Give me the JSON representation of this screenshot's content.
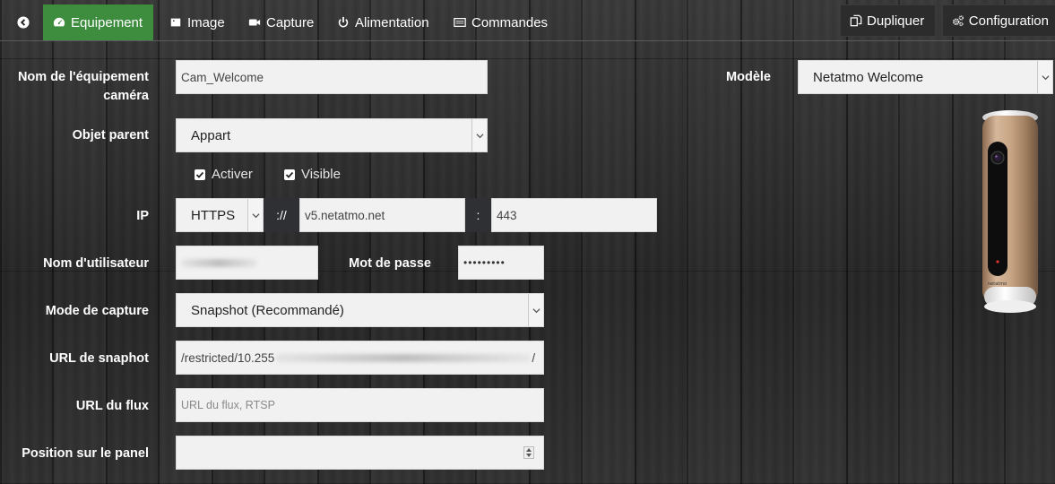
{
  "tabs": {
    "back_icon": "arrow-circle-left-icon",
    "items": [
      {
        "label": "Equipement",
        "icon": "tachometer-icon",
        "active": true
      },
      {
        "label": "Image",
        "icon": "picture-icon",
        "active": false
      },
      {
        "label": "Capture",
        "icon": "video-camera-icon",
        "active": false
      },
      {
        "label": "Alimentation",
        "icon": "power-icon",
        "active": false
      },
      {
        "label": "Commandes",
        "icon": "list-icon",
        "active": false
      }
    ]
  },
  "actions": {
    "duplicate_label": "Dupliquer",
    "configuration_label": "Configuration"
  },
  "form": {
    "name_label": "Nom de l'équipement caméra",
    "name_value": "Cam_Welcome",
    "parent_label": "Objet parent",
    "parent_value": "Appart",
    "activate_label": "Activer",
    "visible_label": "Visible",
    "ip_label": "IP",
    "protocol_value": "HTTPS",
    "protocol_separator": "://",
    "host_value": "v5.netatmo.net",
    "port_separator": ":",
    "port_value": "443",
    "username_label": "Nom d'utilisateur",
    "password_label": "Mot de passe",
    "password_value": "•••••••••",
    "capture_mode_label": "Mode de capture",
    "capture_mode_value": "Snapshot (Recommandé)",
    "snapshot_url_label": "URL de snaphot",
    "snapshot_url_prefix": "/restricted/10.255",
    "snapshot_url_suffix": "/",
    "stream_url_label": "URL du flux",
    "stream_url_placeholder": "URL du flux, RTSP",
    "panel_position_label": "Position sur le panel",
    "model_label": "Modèle",
    "model_value": "Netatmo Welcome"
  },
  "colors": {
    "active_tab": "#3e8d3f",
    "field_bg": "#f1f1f1",
    "addon_bg": "#2e3033"
  }
}
